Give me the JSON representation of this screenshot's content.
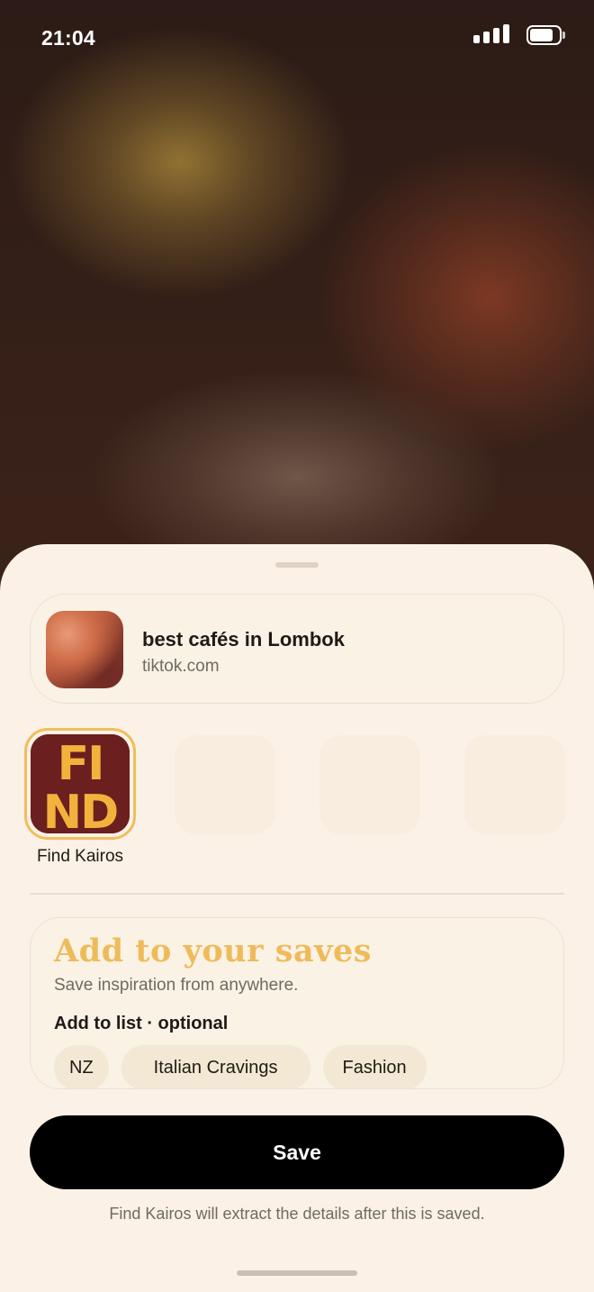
{
  "status_bar": {
    "time": "21:04",
    "signal_icon": "signal-bars-icon",
    "battery_icon": "battery-icon",
    "battery_level": 0.8
  },
  "link_preview": {
    "title": "best cafés in Lombok",
    "domain": "tiktok.com"
  },
  "app_row": {
    "selected_app": {
      "label": "Find Kairos",
      "icon_text": [
        "FI",
        "ND"
      ]
    }
  },
  "saves": {
    "title": "Add to your saves",
    "subtitle": "Save inspiration from anywhere.",
    "list_label": "Add to list · optional",
    "lists": [
      "NZ",
      "Italian Cravings",
      "Fashion"
    ]
  },
  "actions": {
    "save_label": "Save",
    "footnote": "Find Kairos will extract the details after this is saved."
  },
  "colors": {
    "sheet": "#fbf1e6",
    "accent_yellow": "#efbb5a",
    "app_icon_bg": "#6b1f1f",
    "button": "#000000"
  }
}
